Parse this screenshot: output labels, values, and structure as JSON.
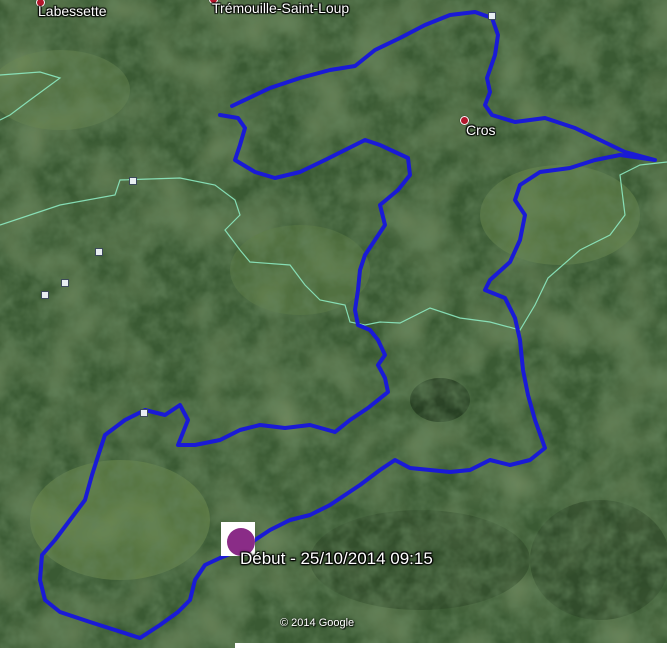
{
  "places": {
    "labessette": "Labessette",
    "tremouille": "Trémouille-Saint-Loup",
    "cros": "Cros"
  },
  "start_label": "Début - 25/10/2014 09:15",
  "copyright": "© 2014 Google",
  "colors": {
    "route": "#1a1ad6",
    "border": "#8ff0c8",
    "pin": "#b2162b",
    "start_marker": "#8a2c87"
  },
  "icons": [
    "place-pin-icon",
    "waypoint-square-icon",
    "start-marker-icon"
  ]
}
